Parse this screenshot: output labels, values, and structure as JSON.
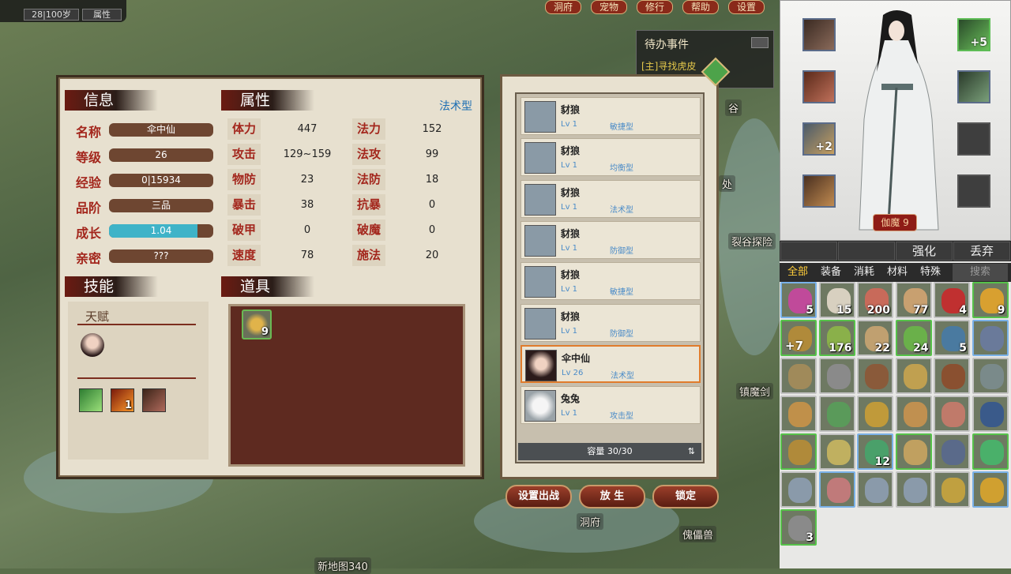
{
  "topbar": {
    "age": "28|100岁",
    "attr": "属性"
  },
  "menu": [
    "洞府",
    "宠物",
    "修行",
    "帮助",
    "设置"
  ],
  "todo": {
    "title": "待办事件",
    "quest": "[主]寻找虎皮"
  },
  "map_labels": [
    "裂谷探险",
    "镇魔剑",
    "洞府",
    "傀儡兽",
    "新地图340",
    "谷",
    "处"
  ],
  "info": {
    "header": "信息",
    "rows": [
      {
        "label": "名称",
        "value": "伞中仙"
      },
      {
        "label": "等级",
        "value": "26"
      },
      {
        "label": "经验",
        "value": "0|15934"
      },
      {
        "label": "品阶",
        "value": "三品"
      },
      {
        "label": "成长",
        "value": "1.04"
      },
      {
        "label": "亲密",
        "value": "???"
      }
    ],
    "growth_fill": 0.85
  },
  "attrs": {
    "header": "属性",
    "type": "法术型",
    "rows": [
      [
        "体力",
        "447",
        "法力",
        "152"
      ],
      [
        "攻击",
        "129~159",
        "法攻",
        "99"
      ],
      [
        "物防",
        "23",
        "法防",
        "18"
      ],
      [
        "暴击",
        "38",
        "抗暴",
        "0"
      ],
      [
        "破甲",
        "0",
        "破魔",
        "0"
      ],
      [
        "速度",
        "78",
        "施法",
        "20"
      ]
    ]
  },
  "skills": {
    "header": "技能",
    "talent": "天赋",
    "skill_counts": [
      "",
      "1",
      ""
    ]
  },
  "items": {
    "header": "道具",
    "slot_count": "9"
  },
  "pets": {
    "rows": [
      {
        "name": "豺狼",
        "lv": "Lv 1",
        "type": "敏捷型"
      },
      {
        "name": "豺狼",
        "lv": "Lv 1",
        "type": "均衡型"
      },
      {
        "name": "豺狼",
        "lv": "Lv 1",
        "type": "法术型"
      },
      {
        "name": "豺狼",
        "lv": "Lv 1",
        "type": "防御型"
      },
      {
        "name": "豺狼",
        "lv": "Lv 1",
        "type": "敏捷型"
      },
      {
        "name": "豺狼",
        "lv": "Lv 1",
        "type": "防御型"
      },
      {
        "name": "伞中仙",
        "lv": "Lv 26",
        "type": "法术型"
      },
      {
        "name": "兔兔",
        "lv": "Lv 1",
        "type": "攻击型"
      }
    ],
    "capacity": "容量 30/30",
    "buttons": {
      "deploy": "设置出战",
      "release": "放 生",
      "lock": "锁定"
    }
  },
  "equip": {
    "plus_right_top": "+5",
    "plus_left_3": "+2",
    "red_button": "伽魔 9"
  },
  "bag": {
    "opts": [
      "强化",
      "丢弃"
    ],
    "tabs": [
      "全部",
      "装备",
      "消耗",
      "材料",
      "特殊"
    ],
    "search": "搜索",
    "cells": [
      {
        "n": "5",
        "p": ""
      },
      {
        "n": "15",
        "p": ""
      },
      {
        "n": "200",
        "p": ""
      },
      {
        "n": "77",
        "p": ""
      },
      {
        "n": "4",
        "p": ""
      },
      {
        "n": "9",
        "p": ""
      },
      {
        "n": "",
        "p": "+7"
      },
      {
        "n": "176",
        "p": ""
      },
      {
        "n": "22",
        "p": ""
      },
      {
        "n": "24",
        "p": ""
      },
      {
        "n": "5",
        "p": ""
      },
      {
        "n": "",
        "p": ""
      },
      {
        "n": "",
        "p": ""
      },
      {
        "n": "",
        "p": ""
      },
      {
        "n": "",
        "p": ""
      },
      {
        "n": "",
        "p": ""
      },
      {
        "n": "",
        "p": ""
      },
      {
        "n": "",
        "p": ""
      },
      {
        "n": "",
        "p": ""
      },
      {
        "n": "",
        "p": ""
      },
      {
        "n": "",
        "p": ""
      },
      {
        "n": "",
        "p": ""
      },
      {
        "n": "",
        "p": ""
      },
      {
        "n": "",
        "p": ""
      },
      {
        "n": "",
        "p": ""
      },
      {
        "n": "",
        "p": ""
      },
      {
        "n": "12",
        "p": ""
      },
      {
        "n": "",
        "p": ""
      },
      {
        "n": "",
        "p": ""
      },
      {
        "n": "",
        "p": ""
      },
      {
        "n": "",
        "p": ""
      },
      {
        "n": "",
        "p": ""
      },
      {
        "n": "",
        "p": ""
      },
      {
        "n": "",
        "p": ""
      },
      {
        "n": "",
        "p": ""
      },
      {
        "n": "",
        "p": ""
      },
      {
        "n": "3",
        "p": ""
      }
    ]
  }
}
